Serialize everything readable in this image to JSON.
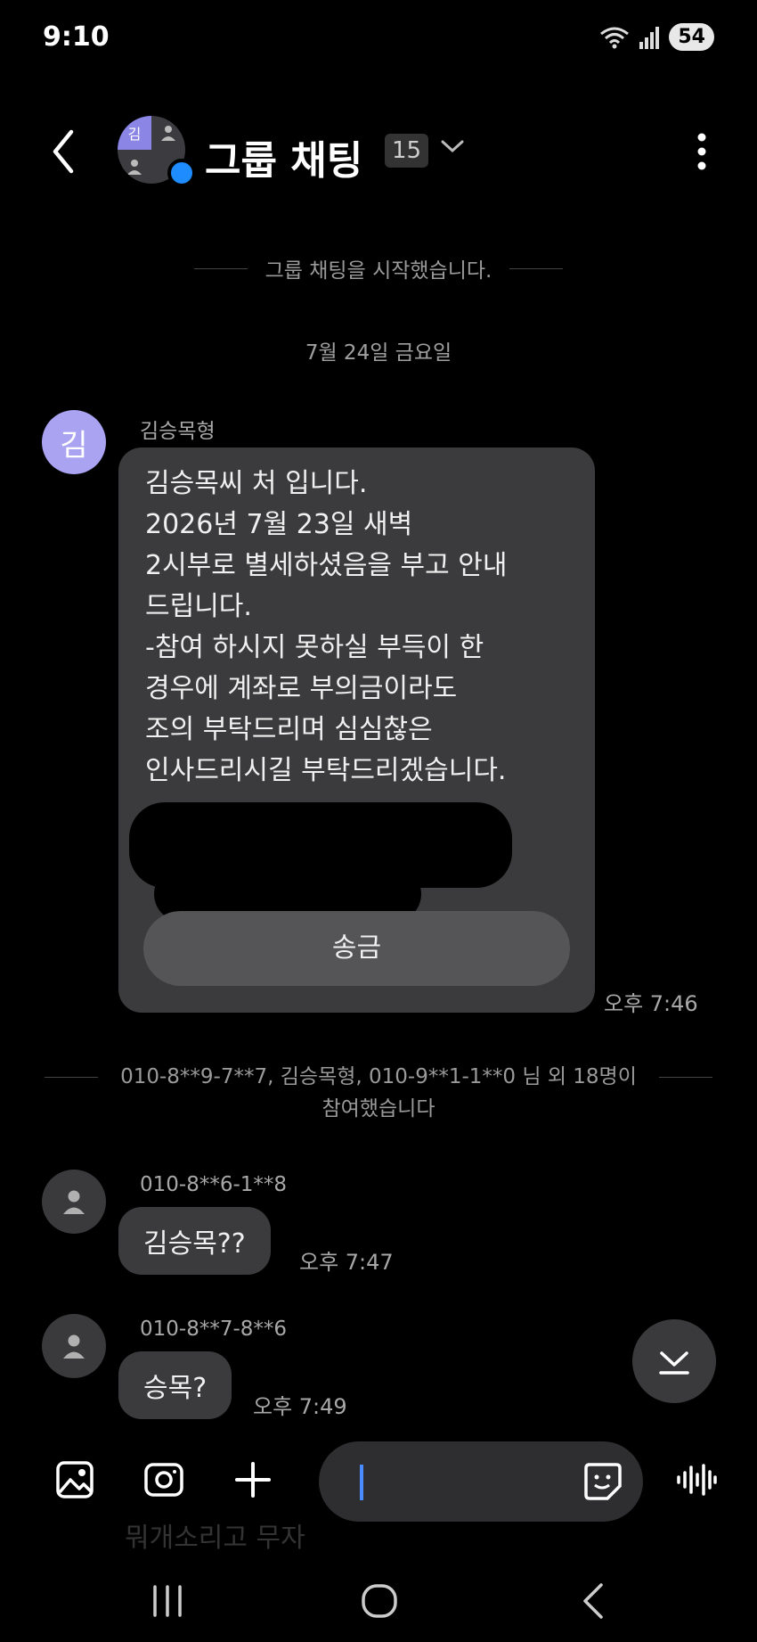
{
  "status_bar": {
    "time": "9:10",
    "battery": "54"
  },
  "header": {
    "title": "그룹 채팅",
    "member_count": "15"
  },
  "system": {
    "started": "그룹 채팅을 시작했습니다.",
    "date": "7월 24일 금요일",
    "joined_line1": "010-8**9-7**7, 김승목형, 010-9**1-1**0 님 외 18명이",
    "joined_line2": "참여했습니다"
  },
  "messages": [
    {
      "sender": "김승목형",
      "avatar_letter": "김",
      "lines": [
        "김승목씨 처 입니다.",
        "2026년 7월 23일 새벽",
        "2시부로 별세하셨음을 부고 안내",
        "드립니다.",
        "-참여 하시지 못하실 부득이 한",
        "경우에 계좌로 부의금이라도",
        "조의 부탁드리며 심심찮은",
        "인사드리시길 부탁드리겠습니다."
      ],
      "button_label": "송금",
      "time": "오후 7:46"
    },
    {
      "sender": "010-8**6-1**8",
      "text": "김승목??",
      "time": "오후 7:47"
    },
    {
      "sender": "010-8**7-8**6",
      "text": "승목?",
      "time": "오후 7:49"
    }
  ],
  "partial_next": {
    "text": "뭐개소리고 무자"
  },
  "colors": {
    "accent": "#1e8cff",
    "avatar_purple": "#a9a3f2",
    "bubble": "#3b3b3d"
  }
}
